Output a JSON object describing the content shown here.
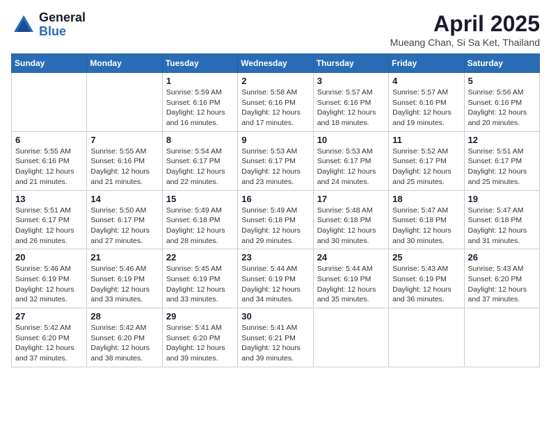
{
  "logo": {
    "general": "General",
    "blue": "Blue"
  },
  "title": "April 2025",
  "subtitle": "Mueang Chan, Si Sa Ket, Thailand",
  "days": [
    "Sunday",
    "Monday",
    "Tuesday",
    "Wednesday",
    "Thursday",
    "Friday",
    "Saturday"
  ],
  "weeks": [
    [
      {
        "num": "",
        "info": ""
      },
      {
        "num": "",
        "info": ""
      },
      {
        "num": "1",
        "info": "Sunrise: 5:59 AM\nSunset: 6:16 PM\nDaylight: 12 hours and 16 minutes."
      },
      {
        "num": "2",
        "info": "Sunrise: 5:58 AM\nSunset: 6:16 PM\nDaylight: 12 hours and 17 minutes."
      },
      {
        "num": "3",
        "info": "Sunrise: 5:57 AM\nSunset: 6:16 PM\nDaylight: 12 hours and 18 minutes."
      },
      {
        "num": "4",
        "info": "Sunrise: 5:57 AM\nSunset: 6:16 PM\nDaylight: 12 hours and 19 minutes."
      },
      {
        "num": "5",
        "info": "Sunrise: 5:56 AM\nSunset: 6:16 PM\nDaylight: 12 hours and 20 minutes."
      }
    ],
    [
      {
        "num": "6",
        "info": "Sunrise: 5:55 AM\nSunset: 6:16 PM\nDaylight: 12 hours and 21 minutes."
      },
      {
        "num": "7",
        "info": "Sunrise: 5:55 AM\nSunset: 6:16 PM\nDaylight: 12 hours and 21 minutes."
      },
      {
        "num": "8",
        "info": "Sunrise: 5:54 AM\nSunset: 6:17 PM\nDaylight: 12 hours and 22 minutes."
      },
      {
        "num": "9",
        "info": "Sunrise: 5:53 AM\nSunset: 6:17 PM\nDaylight: 12 hours and 23 minutes."
      },
      {
        "num": "10",
        "info": "Sunrise: 5:53 AM\nSunset: 6:17 PM\nDaylight: 12 hours and 24 minutes."
      },
      {
        "num": "11",
        "info": "Sunrise: 5:52 AM\nSunset: 6:17 PM\nDaylight: 12 hours and 25 minutes."
      },
      {
        "num": "12",
        "info": "Sunrise: 5:51 AM\nSunset: 6:17 PM\nDaylight: 12 hours and 25 minutes."
      }
    ],
    [
      {
        "num": "13",
        "info": "Sunrise: 5:51 AM\nSunset: 6:17 PM\nDaylight: 12 hours and 26 minutes."
      },
      {
        "num": "14",
        "info": "Sunrise: 5:50 AM\nSunset: 6:17 PM\nDaylight: 12 hours and 27 minutes."
      },
      {
        "num": "15",
        "info": "Sunrise: 5:49 AM\nSunset: 6:18 PM\nDaylight: 12 hours and 28 minutes."
      },
      {
        "num": "16",
        "info": "Sunrise: 5:49 AM\nSunset: 6:18 PM\nDaylight: 12 hours and 29 minutes."
      },
      {
        "num": "17",
        "info": "Sunrise: 5:48 AM\nSunset: 6:18 PM\nDaylight: 12 hours and 30 minutes."
      },
      {
        "num": "18",
        "info": "Sunrise: 5:47 AM\nSunset: 6:18 PM\nDaylight: 12 hours and 30 minutes."
      },
      {
        "num": "19",
        "info": "Sunrise: 5:47 AM\nSunset: 6:18 PM\nDaylight: 12 hours and 31 minutes."
      }
    ],
    [
      {
        "num": "20",
        "info": "Sunrise: 5:46 AM\nSunset: 6:19 PM\nDaylight: 12 hours and 32 minutes."
      },
      {
        "num": "21",
        "info": "Sunrise: 5:46 AM\nSunset: 6:19 PM\nDaylight: 12 hours and 33 minutes."
      },
      {
        "num": "22",
        "info": "Sunrise: 5:45 AM\nSunset: 6:19 PM\nDaylight: 12 hours and 33 minutes."
      },
      {
        "num": "23",
        "info": "Sunrise: 5:44 AM\nSunset: 6:19 PM\nDaylight: 12 hours and 34 minutes."
      },
      {
        "num": "24",
        "info": "Sunrise: 5:44 AM\nSunset: 6:19 PM\nDaylight: 12 hours and 35 minutes."
      },
      {
        "num": "25",
        "info": "Sunrise: 5:43 AM\nSunset: 6:19 PM\nDaylight: 12 hours and 36 minutes."
      },
      {
        "num": "26",
        "info": "Sunrise: 5:43 AM\nSunset: 6:20 PM\nDaylight: 12 hours and 37 minutes."
      }
    ],
    [
      {
        "num": "27",
        "info": "Sunrise: 5:42 AM\nSunset: 6:20 PM\nDaylight: 12 hours and 37 minutes."
      },
      {
        "num": "28",
        "info": "Sunrise: 5:42 AM\nSunset: 6:20 PM\nDaylight: 12 hours and 38 minutes."
      },
      {
        "num": "29",
        "info": "Sunrise: 5:41 AM\nSunset: 6:20 PM\nDaylight: 12 hours and 39 minutes."
      },
      {
        "num": "30",
        "info": "Sunrise: 5:41 AM\nSunset: 6:21 PM\nDaylight: 12 hours and 39 minutes."
      },
      {
        "num": "",
        "info": ""
      },
      {
        "num": "",
        "info": ""
      },
      {
        "num": "",
        "info": ""
      }
    ]
  ]
}
